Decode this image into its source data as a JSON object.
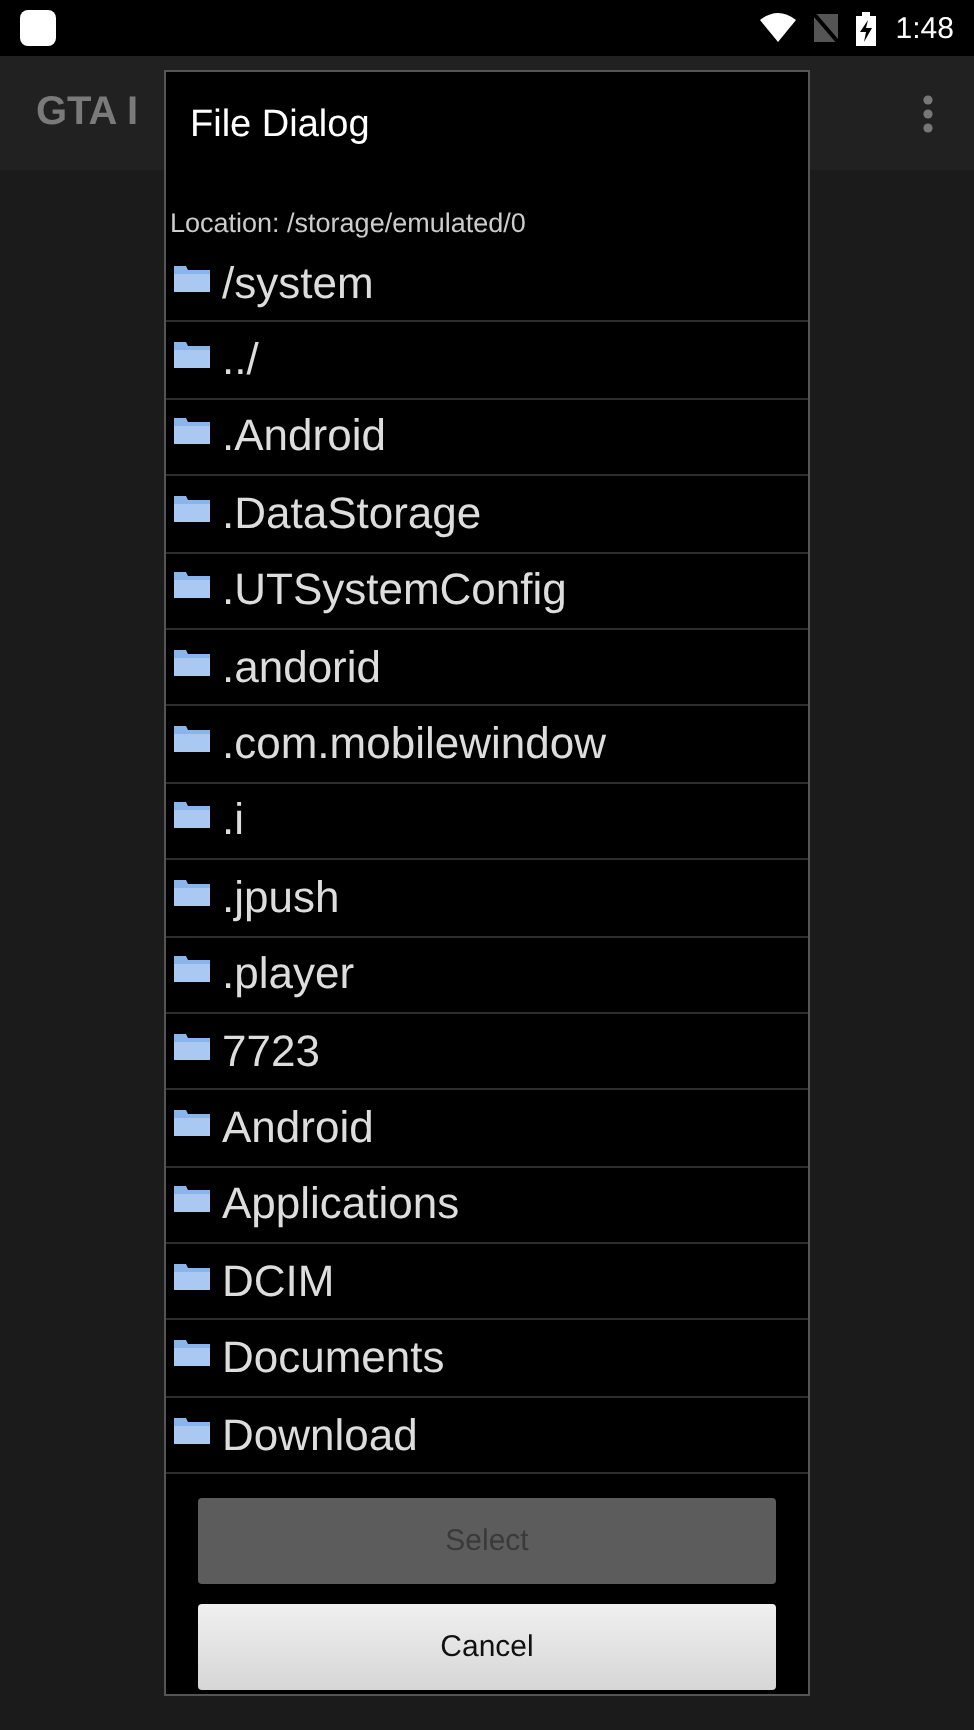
{
  "status_bar": {
    "time": "1:48"
  },
  "app_bar": {
    "title": "GTA I"
  },
  "dialog": {
    "title": "File Dialog",
    "location": "Location: /storage/emulated/0",
    "items": [
      {
        "name": "/system"
      },
      {
        "name": "../"
      },
      {
        "name": ".Android"
      },
      {
        "name": ".DataStorage"
      },
      {
        "name": ".UTSystemConfig"
      },
      {
        "name": ".andorid"
      },
      {
        "name": ".com.mobilewindow"
      },
      {
        "name": ".i"
      },
      {
        "name": ".jpush"
      },
      {
        "name": ".player"
      },
      {
        "name": "7723"
      },
      {
        "name": "Android"
      },
      {
        "name": "Applications"
      },
      {
        "name": "DCIM"
      },
      {
        "name": "Documents"
      },
      {
        "name": "Download"
      }
    ],
    "buttons": [
      {
        "label": "Select",
        "disabled": true
      },
      {
        "label": "Cancel",
        "disabled": false
      }
    ]
  }
}
